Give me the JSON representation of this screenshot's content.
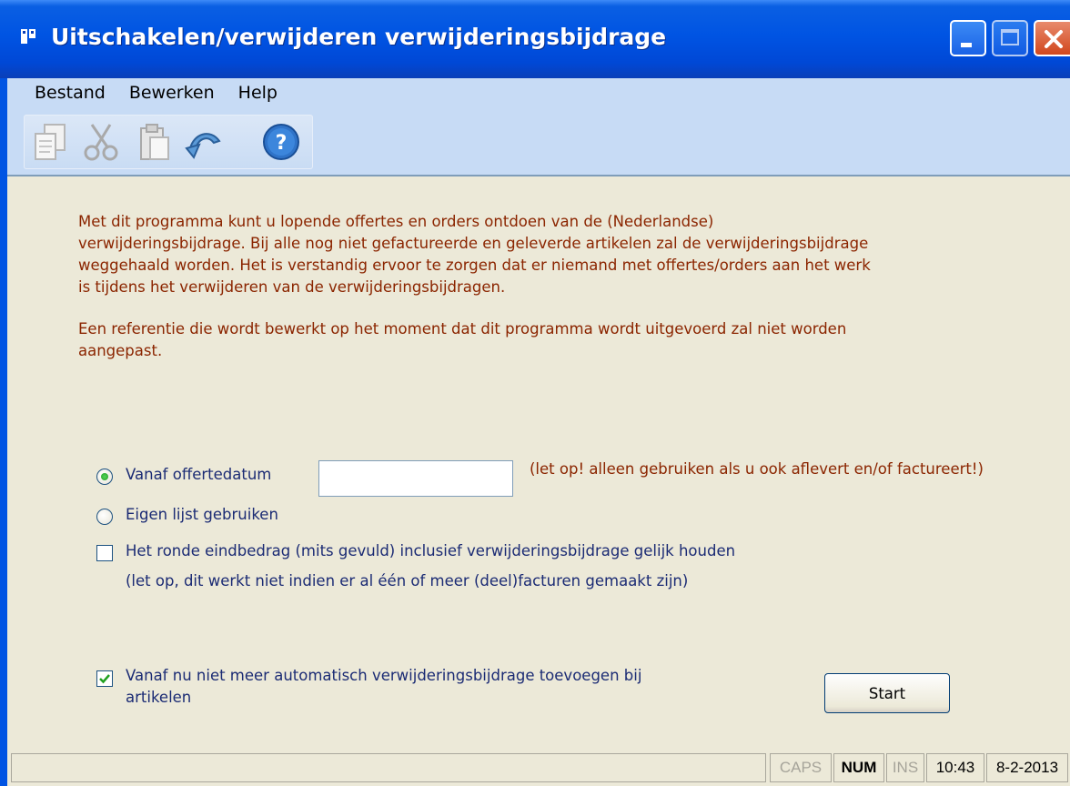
{
  "window": {
    "title": "Uitschakelen/verwijderen verwijderingsbijdrage"
  },
  "menu": {
    "items": [
      "Bestand",
      "Bewerken",
      "Help"
    ]
  },
  "toolbar": {
    "icons": [
      "copy-icon",
      "cut-icon",
      "paste-icon",
      "undo-icon",
      "help-icon"
    ]
  },
  "description": {
    "paragraph1": "Met dit programma kunt u lopende offertes en orders ontdoen van de (Nederlandse)\nverwijderingsbijdrage. Bij alle nog niet gefactureerde en geleverde artikelen zal de verwijderingsbijdrage\nweggehaald worden. Het is verstandig ervoor te zorgen dat er niemand met offertes/orders aan het werk\nis tijdens het verwijderen van de verwijderingsbijdragen.",
    "paragraph2": "Een referentie die wordt bewerkt op het moment dat dit programma wordt uitgevoerd zal niet worden\naangepast."
  },
  "options": {
    "radio1": {
      "label": "Vanaf offertedatum",
      "selected": true
    },
    "date_value": "",
    "date_note": "(let op! alleen gebruiken als u ook aflevert en/of factureert!)",
    "radio2": {
      "label": "Eigen lijst gebruiken",
      "selected": false
    },
    "check1": {
      "line1": "Het ronde eindbedrag (mits gevuld) inclusief verwijderingsbijdrage gelijk houden",
      "line2": "(let op, dit werkt niet indien er al één of meer (deel)facturen gemaakt zijn)",
      "checked": false
    },
    "check2": {
      "line1": "Vanaf nu niet meer automatisch verwijderingsbijdrage toevoegen bij",
      "line2": "artikelen",
      "checked": true
    }
  },
  "start_label": "Start",
  "status": {
    "caps": "CAPS",
    "num": "NUM",
    "ins": "INS",
    "time": "10:43",
    "date": "8-2-2013"
  }
}
